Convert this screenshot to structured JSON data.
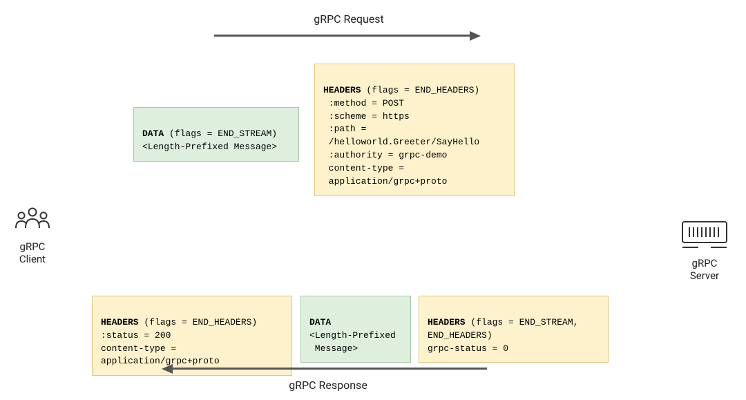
{
  "request_label": "gRPC Request",
  "response_label": "gRPC Response",
  "client_label": "gRPC\nClient",
  "server_label": "gRPC\nServer",
  "request_data_box": {
    "title": "DATA",
    "flags": " (flags = END_STREAM)",
    "body": "<Length-Prefixed Message>"
  },
  "request_headers_box": {
    "title": "HEADERS",
    "flags": " (flags = END_HEADERS)",
    "body": " :method = POST\n :scheme = https\n :path =\n /helloworld.Greeter/SayHello\n :authority = grpc-demo\n content-type =\n application/grpc+proto"
  },
  "response_headers_box": {
    "title": "HEADERS",
    "flags": " (flags = END_HEADERS)",
    "body": ":status = 200\ncontent-type =\napplication/grpc+proto"
  },
  "response_data_box": {
    "title": "DATA",
    "flags": "",
    "body": "<Length-Prefixed\n Message>"
  },
  "response_trailers_box": {
    "title": "HEADERS",
    "flags": " (flags = END_STREAM,\nEND_HEADERS)",
    "body": "grpc-status = 0"
  }
}
